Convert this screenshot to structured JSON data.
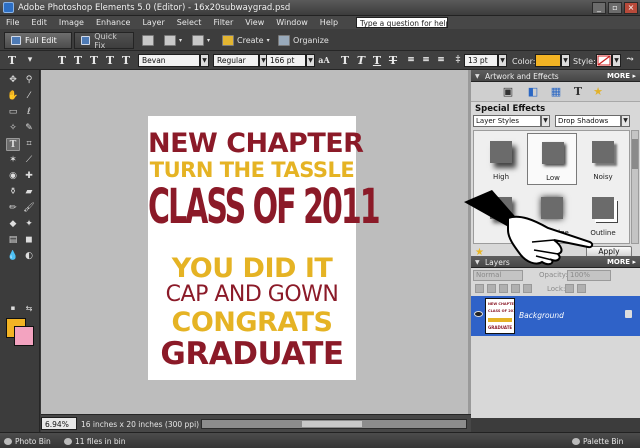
{
  "window": {
    "title": "Adobe Photoshop Elements 5.0 (Editor) - 16x20subwaygrad.psd",
    "controls": [
      "_",
      "▫",
      "×"
    ]
  },
  "menu": {
    "items": [
      "File",
      "Edit",
      "Image",
      "Enhance",
      "Layer",
      "Select",
      "Filter",
      "View",
      "Window",
      "Help"
    ],
    "help_placeholder": "Type a question for help"
  },
  "modebar": {
    "full_edit": "Full Edit",
    "quick_fix": "Quick Fix",
    "create": "Create",
    "organize": "Organize"
  },
  "options": {
    "font_family": "Bevan",
    "font_style": "Regular",
    "font_size": "166 pt",
    "leading": "13 pt",
    "color_label": "Color:",
    "style_label": "Style:",
    "color_hex": "#f2b324"
  },
  "canvas": {
    "zoom": "6.94%",
    "doc_info": "16 inches x 20 inches (300 ppi)",
    "poster": [
      {
        "text": "NEW CHAPTER",
        "color": "#8b1a28"
      },
      {
        "text": "TURN THE TASSLE",
        "color": "#e5b324"
      },
      {
        "text": "CLASS OF 2011",
        "color": "#8b1a28"
      },
      {
        "text": "YOU DID IT",
        "color": "#e5b324"
      },
      {
        "text": "CAP AND GOWN",
        "color": "#8b1a28"
      },
      {
        "text": "CONGRATS",
        "color": "#e5b324"
      },
      {
        "text": "GRADUATE",
        "color": "#8b1a28"
      }
    ]
  },
  "panels": {
    "artwork": {
      "title": "Artwork and Effects",
      "more": "MORE ▸",
      "special_effects": "Special Effects",
      "category": "Layer Styles",
      "subcategory": "Drop Shadows",
      "effects": [
        "High",
        "Low",
        "Noisy",
        "",
        "Soft Edge",
        "Outline"
      ],
      "apply": "Apply"
    },
    "layers": {
      "title": "Layers",
      "more": "MORE ▸",
      "blend_mode": "Normal",
      "opacity_label": "Opacity:",
      "opacity_value": "100%",
      "lock_label": "Lock:",
      "layer_name": "Background",
      "thumb_text": [
        "NEW CHAPTER",
        "CLASS OF 2011",
        "GRADUATE"
      ]
    }
  },
  "bin": {
    "photo_bin": "Photo Bin",
    "files": "11 files in bin",
    "palette_bin": "Palette Bin"
  }
}
